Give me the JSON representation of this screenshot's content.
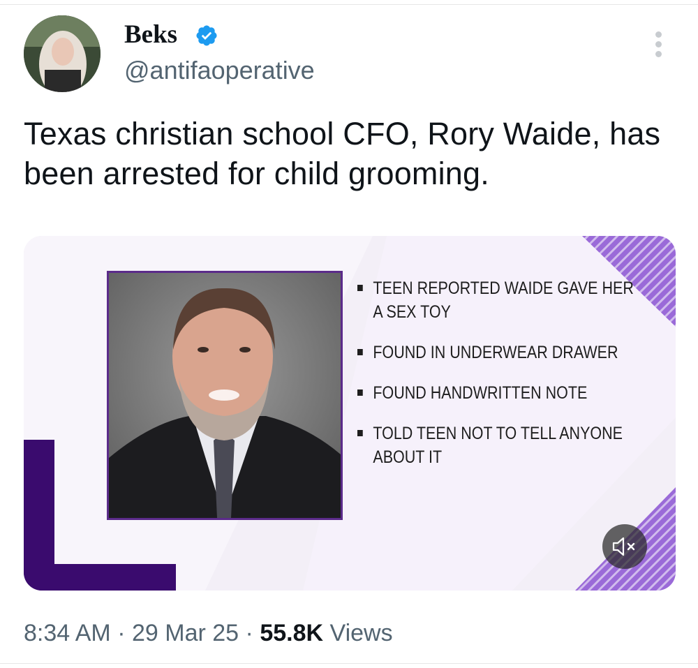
{
  "author": {
    "name": "Beks",
    "handle": "@antifaoperative"
  },
  "tweet": {
    "text": "Texas christian school CFO, Rory Waide, has been arrested for child grooming."
  },
  "media": {
    "bullets": [
      "TEEN REPORTED WAIDE GAVE HER A SEX TOY",
      "FOUND IN UNDERWEAR DRAWER",
      "FOUND HANDWRITTEN NOTE",
      "TOLD TEEN NOT TO TELL ANYONE ABOUT IT"
    ],
    "mute_icon": "speaker-muted-icon"
  },
  "meta": {
    "time": "8:34 AM",
    "separator": "·",
    "date": "29 Mar 25",
    "views_count": "55.8K",
    "views_label": "Views"
  },
  "colors": {
    "verified": "#1d9bf0",
    "accent_purple": "#5b2b8a",
    "stripe_purple": "#8c5bd0",
    "secondary_text": "#536471"
  },
  "icons": {
    "verified": "verified-badge-icon",
    "more": "more-options-icon"
  }
}
